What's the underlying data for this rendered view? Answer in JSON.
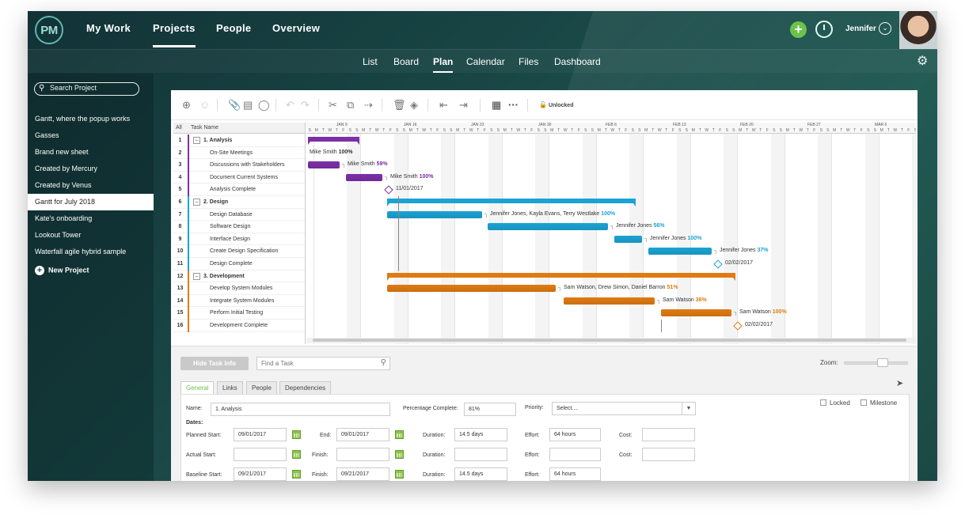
{
  "app": {
    "logo": "PM"
  },
  "topnav": {
    "items": [
      "My Work",
      "Projects",
      "People",
      "Overview"
    ],
    "active": "Projects",
    "user": "Jennifer"
  },
  "subnav": {
    "items": [
      "List",
      "Board",
      "Plan",
      "Calendar",
      "Files",
      "Dashboard"
    ],
    "active": "Plan"
  },
  "sidebar": {
    "search_placeholder": "Search Project",
    "projects": [
      "Gantt, where the popup works",
      "Gasses",
      "Brand new sheet",
      "Created by Mercury",
      "Created by Venus",
      "Gantt for July 2018",
      "Kate's onboarding",
      "Lookout Tower",
      "Waterfall agile hybrid sample"
    ],
    "selected": "Gantt for July 2018",
    "new_project": "New Project"
  },
  "toolbar": {
    "lock_status": "Unlocked"
  },
  "grid": {
    "col_all": "All",
    "col_name": "Task Name",
    "rows": [
      {
        "num": "1",
        "name": "1. Analysis",
        "summary": true,
        "color": "#7b2fa8"
      },
      {
        "num": "2",
        "name": "On-Site Meetings",
        "summary": false,
        "color": "#7b2fa8"
      },
      {
        "num": "3",
        "name": "Discussions with Stakeholders",
        "summary": false,
        "color": "#7b2fa8"
      },
      {
        "num": "4",
        "name": "Document Current Systems",
        "summary": false,
        "color": "#7b2fa8"
      },
      {
        "num": "5",
        "name": "Analysis Complete",
        "summary": false,
        "color": "#7b2fa8"
      },
      {
        "num": "6",
        "name": "2. Design",
        "summary": true,
        "color": "#1ba3d4"
      },
      {
        "num": "7",
        "name": "Design Database",
        "summary": false,
        "color": "#1ba3d4"
      },
      {
        "num": "8",
        "name": "Software Design",
        "summary": false,
        "color": "#1ba3d4"
      },
      {
        "num": "9",
        "name": "Interface Design",
        "summary": false,
        "color": "#1ba3d4"
      },
      {
        "num": "10",
        "name": "Create Design Specification",
        "summary": false,
        "color": "#1ba3d4"
      },
      {
        "num": "11",
        "name": "Design Complete",
        "summary": false,
        "color": "#1ba3d4"
      },
      {
        "num": "12",
        "name": "3. Development",
        "summary": true,
        "color": "#e07b13"
      },
      {
        "num": "13",
        "name": "Develop System Modules",
        "summary": false,
        "color": "#e07b13"
      },
      {
        "num": "14",
        "name": "Integrate System Modules",
        "summary": false,
        "color": "#e07b13"
      },
      {
        "num": "15",
        "name": "Perform Initial Testing",
        "summary": false,
        "color": "#e07b13"
      },
      {
        "num": "16",
        "name": "Development Complete",
        "summary": false,
        "color": "#e07b13"
      }
    ]
  },
  "timeline": {
    "weeks": [
      "JAN 9",
      "JAN 16",
      "JAN 23",
      "JAN 30",
      "FEB 6",
      "FEB 13",
      "FEB 20",
      "FEB 27",
      "MAR 6"
    ],
    "day_letters": [
      "S",
      "M",
      "T",
      "W",
      "T",
      "F",
      "S"
    ]
  },
  "gantt_labels": [
    {
      "row": 1,
      "who": "Mike Smith",
      "pct": "100%"
    },
    {
      "row": 2,
      "who": "Mike Smith",
      "pct": "59%"
    },
    {
      "row": 3,
      "who": "Mike Smith",
      "pct": "100%"
    },
    {
      "row": 4,
      "who": "11/01/2017",
      "pct": ""
    },
    {
      "row": 6,
      "who": "Jennifer Jones, Kayla Evans, Terry Westlake",
      "pct": "100%"
    },
    {
      "row": 7,
      "who": "Jennifer Jones",
      "pct": "56%"
    },
    {
      "row": 8,
      "who": "Jennifer Jones",
      "pct": "100%"
    },
    {
      "row": 9,
      "who": "Jennifer Jones",
      "pct": "37%"
    },
    {
      "row": 10,
      "who": "02/02/2017",
      "pct": ""
    },
    {
      "row": 12,
      "who": "Sam Watson, Drew Simon, Daniel Barron",
      "pct": "51%"
    },
    {
      "row": 13,
      "who": "Sam Watson",
      "pct": "36%"
    },
    {
      "row": 14,
      "who": "Sam Watson",
      "pct": "100%"
    },
    {
      "row": 15,
      "who": "02/02/2017",
      "pct": ""
    }
  ],
  "bottom": {
    "hide_button": "Hide Task Info",
    "find_placeholder": "Find a Task",
    "zoom_label": "Zoom:",
    "tabs": [
      "General",
      "Links",
      "People",
      "Dependencies"
    ],
    "active_tab": "General",
    "form": {
      "name_label": "Name:",
      "name_value": "1. Analysis",
      "pct_label": "Percentage Complete:",
      "pct_value": "81%",
      "priority_label": "Priority:",
      "priority_value": "Select....",
      "locked_label": "Locked",
      "milestone_label": "Milestone",
      "dates_label": "Dates:",
      "planned_start_label": "Planned Start:",
      "planned_start": "09/01/2017",
      "end_label": "End:",
      "end_value": "09/01/2017",
      "duration_label": "Duration:",
      "duration_1": "14.5 days",
      "effort_label": "Effort:",
      "effort_1": "64 hours",
      "cost_label": "Cost:",
      "actual_start_label": "Actual Start:",
      "finish_label": "Finish:",
      "baseline_start_label": "Baseline Start:",
      "baseline_start": "09/21/2017",
      "baseline_finish": "09/21/2017",
      "duration_3": "14.5 days",
      "effort_3": "64 hours"
    }
  }
}
